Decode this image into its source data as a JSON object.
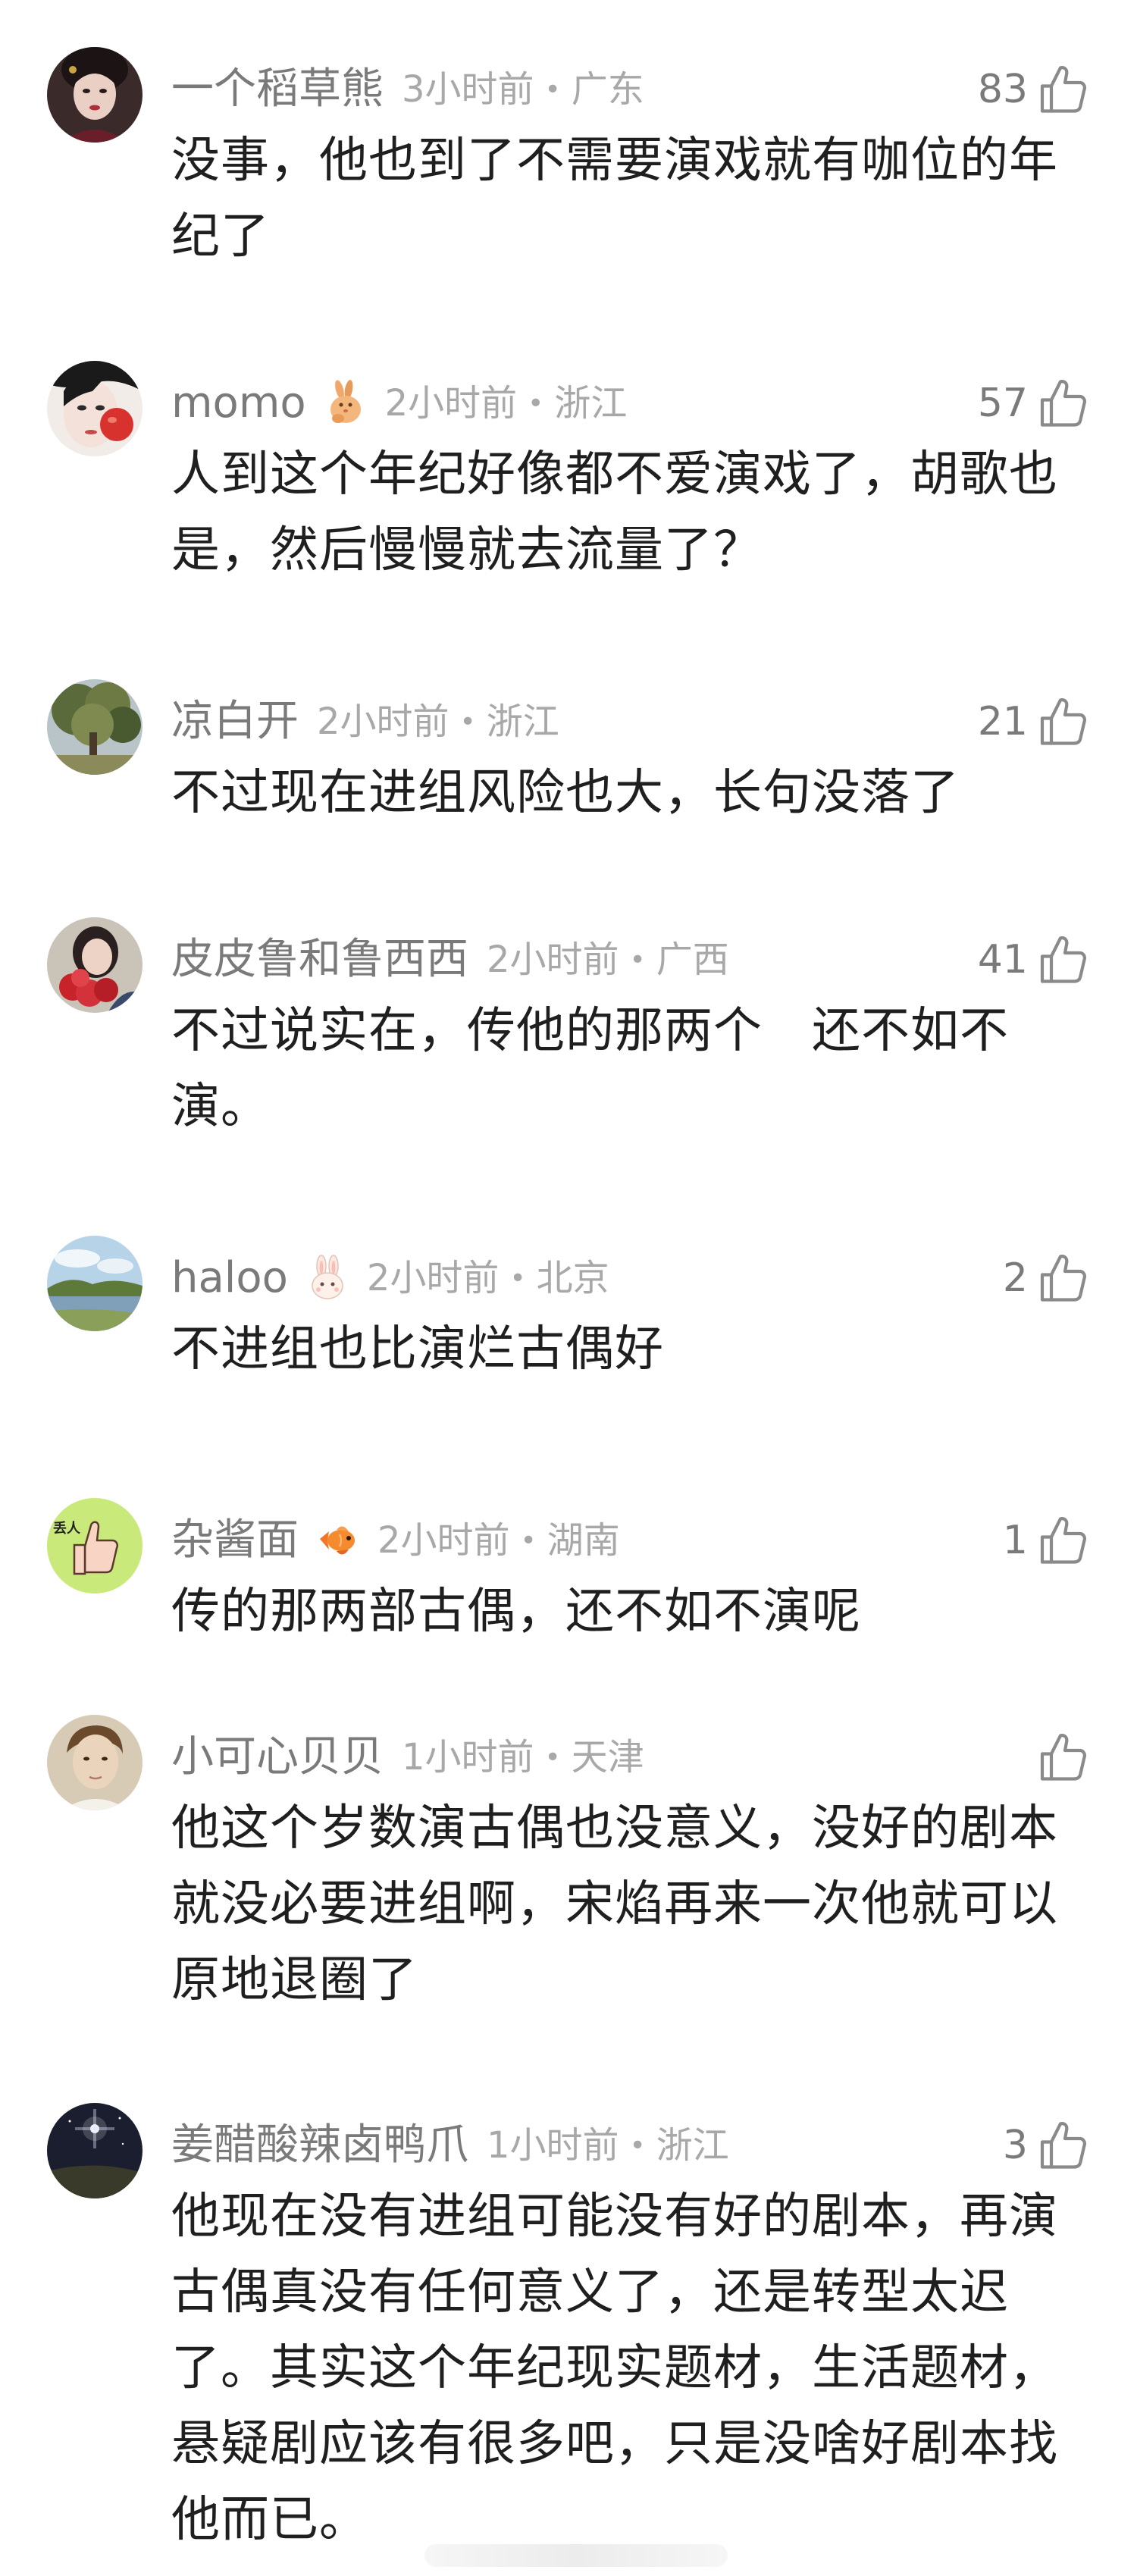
{
  "comments": [
    {
      "username": "一个稻草熊",
      "time": "3小时前",
      "dot": "•",
      "location": "广东",
      "likes": "83",
      "text": "没事，他也到了不需要演戏就有咖位的年纪了",
      "avatar_icon": "avatar-woman-portrait"
    },
    {
      "username": "momo",
      "badge_icon": "rabbit-badge-icon",
      "time": "2小时前",
      "dot": "•",
      "location": "浙江",
      "likes": "57",
      "text": "人到这个年纪好像都不爱演戏了，胡歌也是，然后慢慢就去流量了？",
      "avatar_icon": "avatar-woman-apple"
    },
    {
      "username": "凉白开",
      "time": "2小时前",
      "dot": "•",
      "location": "浙江",
      "likes": "21",
      "text": "不过现在进组风险也大，长句没落了",
      "avatar_icon": "avatar-tree-landscape"
    },
    {
      "username": "皮皮鲁和鲁西西",
      "time": "2小时前",
      "dot": "•",
      "location": "广西",
      "likes": "41",
      "text": "不过说实在，传他的那两个　还不如不演。",
      "avatar_icon": "avatar-girl-roses"
    },
    {
      "username": "haloo",
      "badge_icon": "bunny-badge-icon",
      "time": "2小时前",
      "dot": "•",
      "location": "北京",
      "likes": "2",
      "text": "不进组也比演烂古偶好",
      "avatar_icon": "avatar-lake-landscape"
    },
    {
      "username": "杂酱面",
      "badge_icon": "goldfish-badge-icon",
      "time": "2小时前",
      "dot": "•",
      "location": "湖南",
      "likes": "1",
      "text": "传的那两部古偶，还不如不演呢",
      "avatar_icon": "avatar-thumbs-up-cartoon",
      "avatar_text": "丢人"
    },
    {
      "username": "小可心贝贝",
      "time": "1小时前",
      "dot": "•",
      "location": "天津",
      "likes": "",
      "text": "他这个岁数演古偶也没意义，没好的剧本就没必要进组啊，宋焰再来一次他就可以原地退圈了",
      "avatar_icon": "avatar-man-portrait"
    },
    {
      "username": "姜醋酸辣卤鸭爪",
      "time": "1小时前",
      "dot": "•",
      "location": "浙江",
      "likes": "3",
      "text": "他现在没有进组可能没有好的剧本，再演古偶真没有任何意义了，还是转型太迟了。其实这个年纪现实题材，生活题材，悬疑剧应该有很多吧，只是没啥好剧本找他而已。",
      "avatar_icon": "avatar-night-sky"
    }
  ]
}
